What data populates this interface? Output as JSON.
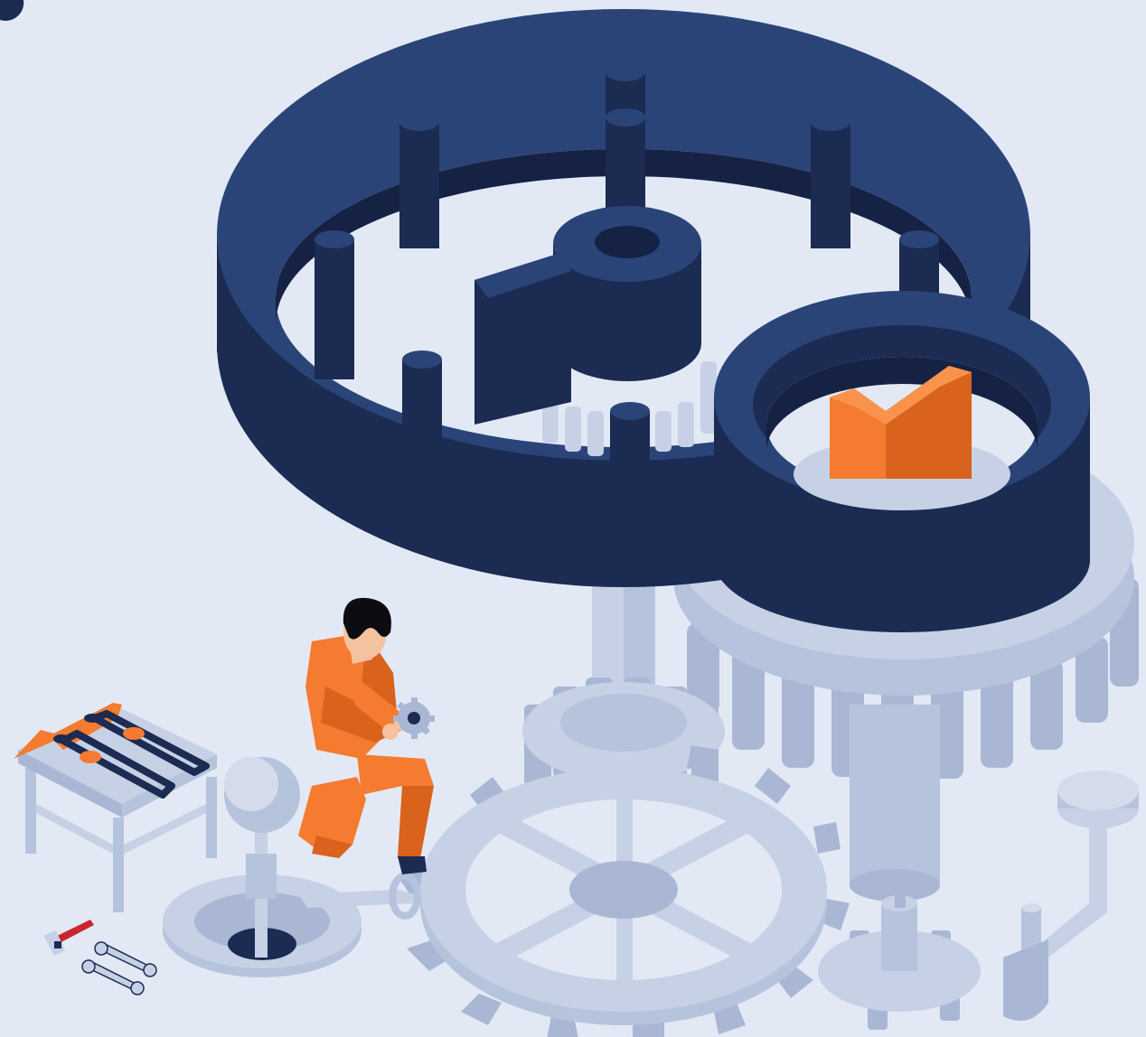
{
  "scene": {
    "subject": "isometric-gear-mechanism",
    "icons": [
      "gear-icon",
      "wrench-icon",
      "hammer-icon",
      "tool-rack-icon",
      "worker-figure"
    ]
  },
  "colors": {
    "background": "#e2e9f5",
    "navy_top": "#2b4478",
    "navy_side": "#1b2b52",
    "navy_dark": "#152244",
    "gear_light": "#c6d1e6",
    "gear_mid": "#a9b7d4",
    "gear_dark": "#8e9dbd",
    "accent_orange": "#f47b2f",
    "accent_orange_dark": "#d9621c",
    "skin": "#f5c2a0",
    "hair": "#0b0d12"
  }
}
